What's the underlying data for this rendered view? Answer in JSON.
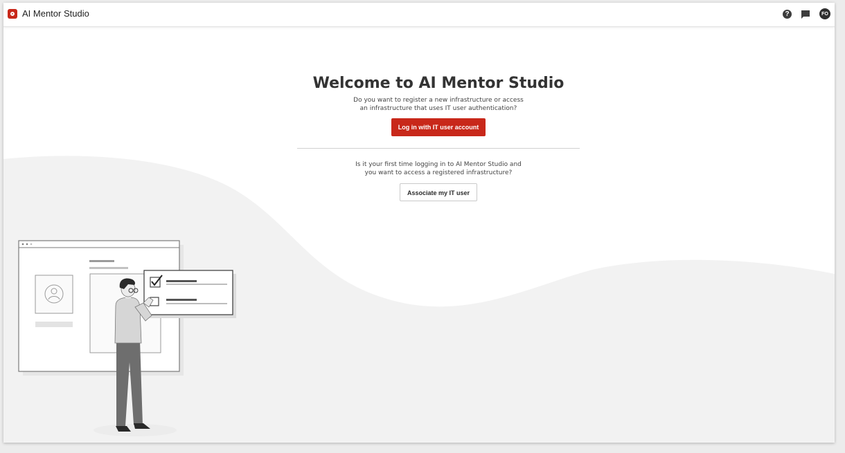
{
  "app": {
    "title": "AI Mentor Studio"
  },
  "header": {
    "help_icon": "?",
    "chat_icon": "chat-bubble-icon",
    "avatar_initials": "FO"
  },
  "welcome": {
    "title": "Welcome to AI Mentor Studio",
    "subtitle_line1": "Do you want to register a new infrastructure or access",
    "subtitle_line2": "an infrastructure that uses IT user authentication?",
    "login_button": "Log in with IT user account",
    "first_time_line1": "Is it your first time logging in to AI Mentor Studio and",
    "first_time_line2": "you want to access a registered infrastructure?",
    "associate_button": "Associate my IT user"
  },
  "colors": {
    "brand_red": "#c8281a",
    "text_dark": "#333333",
    "wave_gray": "#f2f2f2"
  }
}
